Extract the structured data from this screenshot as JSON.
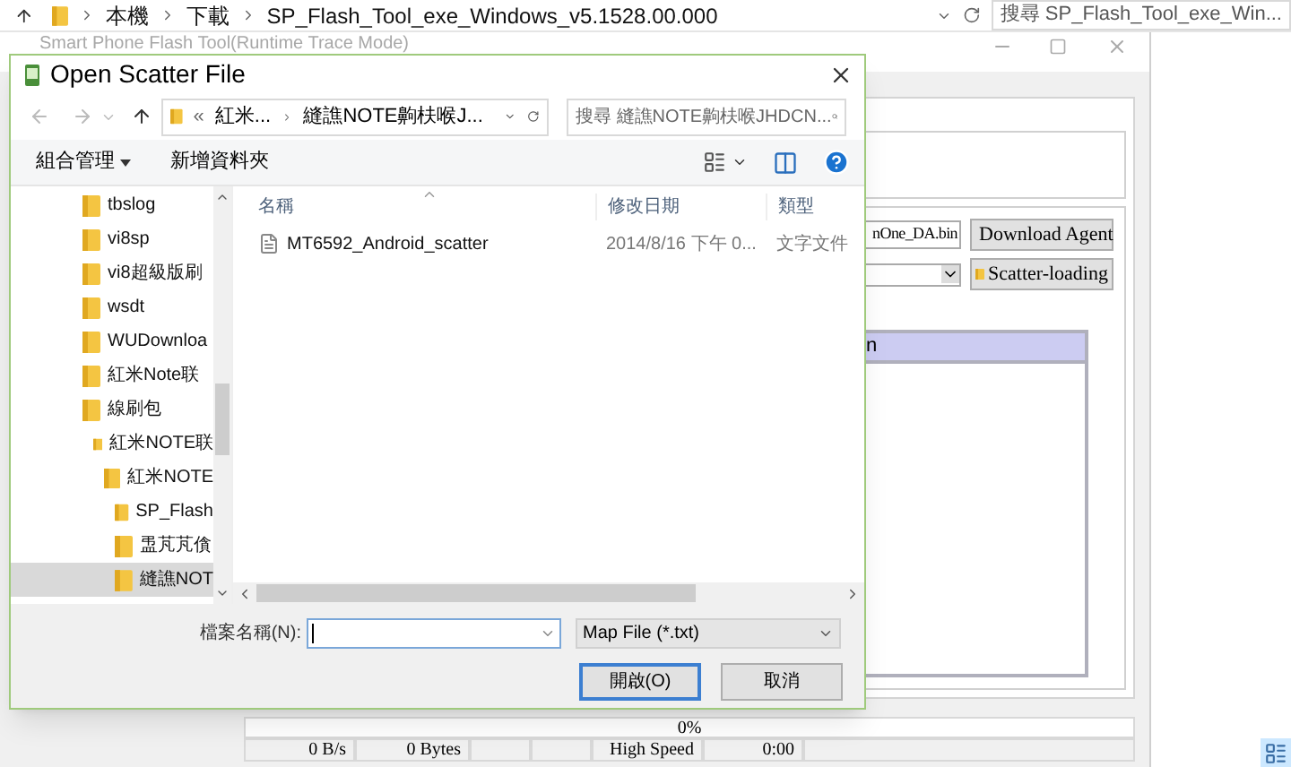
{
  "explorer": {
    "breadcrumbs": [
      "本機",
      "下載",
      "SP_Flash_Tool_exe_Windows_v5.1528.00.000"
    ],
    "search_placeholder": "搜尋 SP_Flash_Tool_exe_Win..."
  },
  "flash_tool": {
    "title": "Smart Phone Flash Tool(Runtime Trace Mode)",
    "da_field": {
      "value": "nOne_DA.bin"
    },
    "buttons": [
      "Download Agent",
      "Scatter-loading"
    ],
    "table": {
      "header": "n"
    },
    "progress": {
      "text": "0%",
      "level": 0
    },
    "status": [
      {
        "kind": "text",
        "text": "0 B/s"
      },
      {
        "kind": "text",
        "text": "0 Bytes"
      },
      {
        "kind": "blank"
      },
      {
        "kind": "blank"
      },
      {
        "kind": "text",
        "text": "High Speed"
      },
      {
        "kind": "text",
        "text": "0:00"
      },
      {
        "kind": "blank"
      }
    ]
  },
  "dialog": {
    "title": "Open Scatter File",
    "address_overflow": "«",
    "address": [
      "紅米...",
      "縫譙NOTE齁枎喉J..."
    ],
    "search_placeholder": "搜尋 縫譙NOTE齁枎喉JHDCN...",
    "toolbar": [
      {
        "kind": "menu",
        "label": "組合管理"
      },
      {
        "kind": "button",
        "label": "新增資料夾"
      }
    ],
    "nav": [
      {
        "label": "tbslog",
        "selected": false
      },
      {
        "label": "vi8sp",
        "selected": false
      },
      {
        "label": "vi8超級版刷",
        "selected": false
      },
      {
        "label": "wsdt",
        "selected": false
      },
      {
        "label": "WUDownloa",
        "selected": false
      },
      {
        "label": "紅米Note联",
        "selected": false
      },
      {
        "label": "線刷包",
        "selected": false,
        "children": [
          {
            "label": "紅米NOTE联",
            "selected": false,
            "children": [
              {
                "label": "紅米NOTE",
                "selected": false,
                "children": [
                  {
                    "label": "SP_Flash",
                    "selected": false
                  },
                  {
                    "label": "盄芃芃僋",
                    "selected": false
                  },
                  {
                    "label": "縫譙NOT",
                    "selected": true
                  }
                ]
              }
            ]
          }
        ]
      }
    ],
    "columns": [
      "名稱",
      "修改日期",
      "類型"
    ],
    "files": [
      {
        "name": "MT6592_Android_scatter",
        "modified": "2014/8/16 下午 0...",
        "type": "文字文件"
      }
    ],
    "filename": {
      "label": "檔案名稱(N):"
    },
    "filter": "Map File (*.txt)",
    "buttons": [
      {
        "label": "開啟(O)",
        "default": true
      },
      {
        "label": "取消",
        "default": false
      }
    ]
  }
}
